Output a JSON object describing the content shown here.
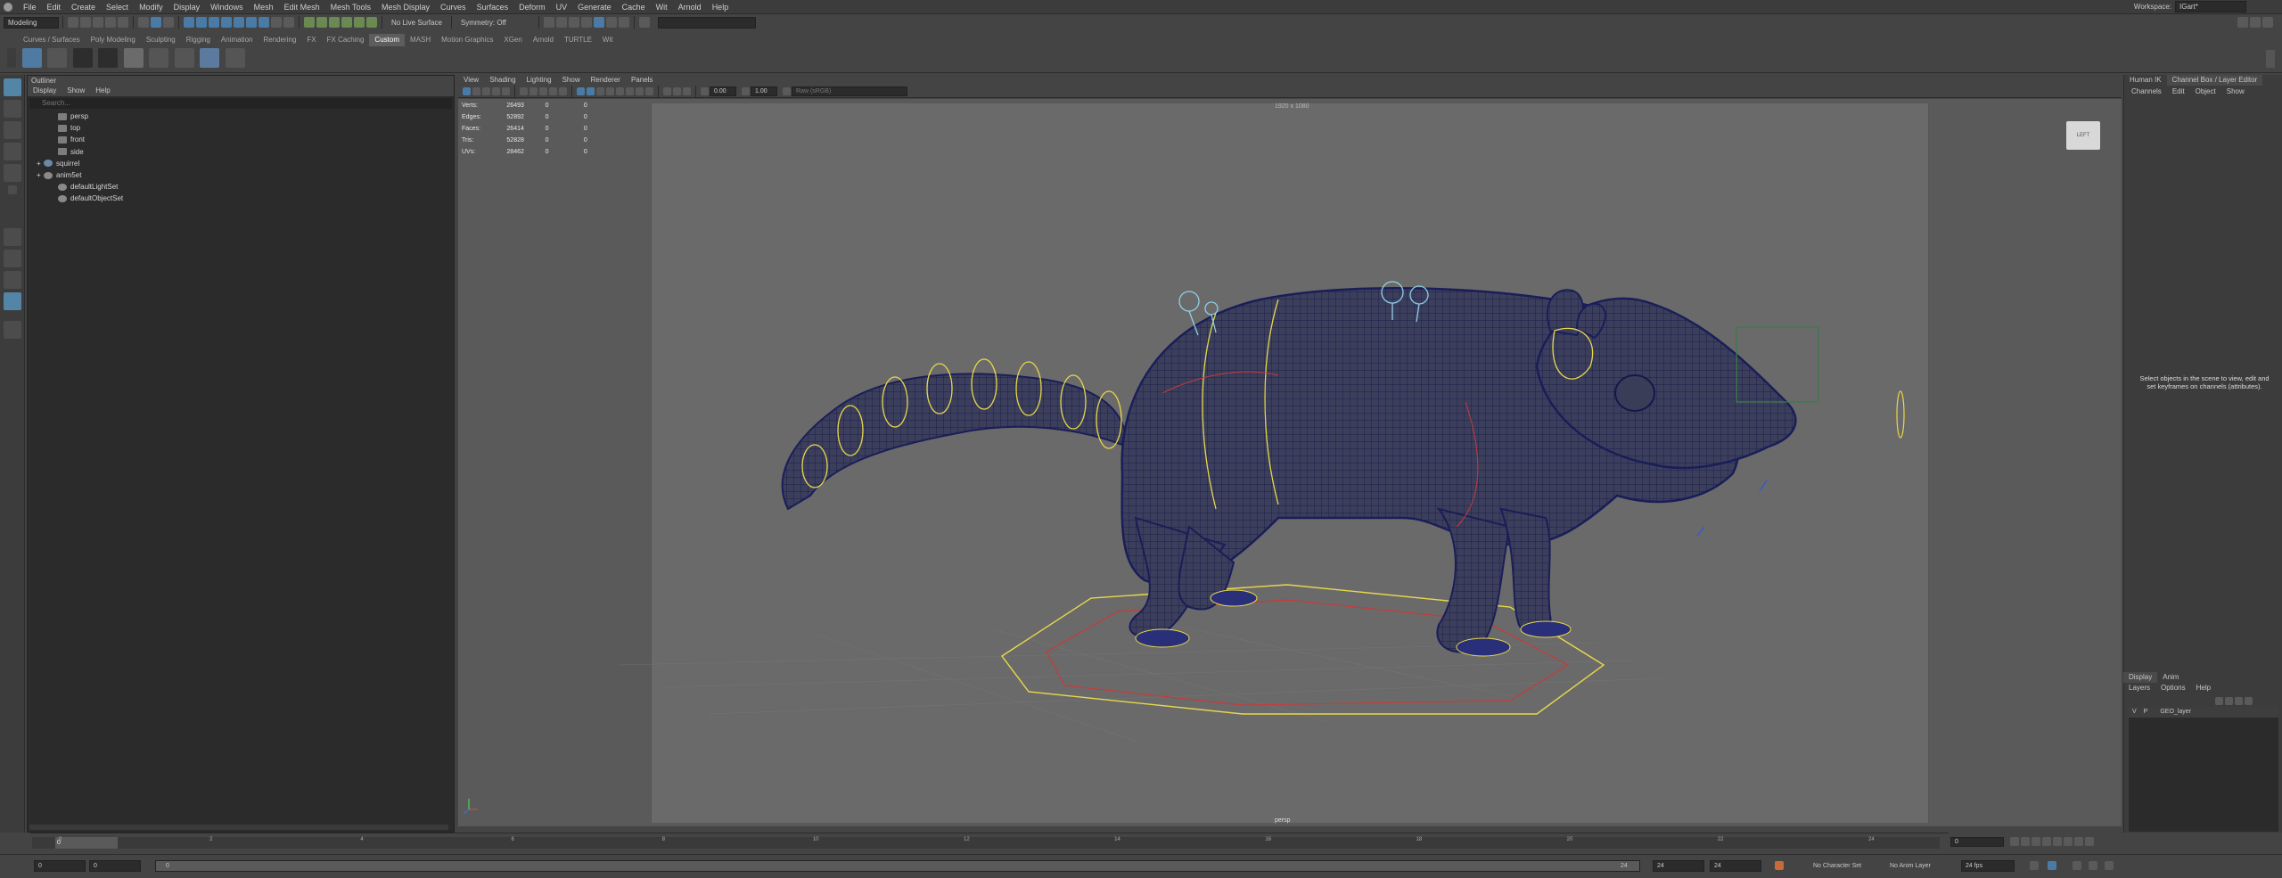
{
  "menus": [
    "File",
    "Edit",
    "Create",
    "Select",
    "Modify",
    "Display",
    "Windows",
    "Mesh",
    "Edit Mesh",
    "Mesh Tools",
    "Mesh Display",
    "Curves",
    "Surfaces",
    "Deform",
    "UV",
    "Generate",
    "Cache",
    "Wit",
    "Arnold",
    "Help"
  ],
  "mode_menu": "Modeling",
  "workspace_label": "Workspace:",
  "workspace_value": "IGart*",
  "live_surface": "No Live Surface",
  "symmetry": "Symmetry: Off",
  "shelf_tabs": [
    "Curves / Surfaces",
    "Poly Modeling",
    "Sculpting",
    "Rigging",
    "Animation",
    "Rendering",
    "FX",
    "FX Caching",
    "Custom",
    "MASH",
    "Motion Graphics",
    "XGen",
    "Arnold",
    "TURTLE",
    "Wit"
  ],
  "shelf_active": "Custom",
  "outliner": {
    "title": "Outliner",
    "menu": [
      "Display",
      "Show",
      "Help"
    ],
    "search_placeholder": "Search...",
    "items": [
      {
        "label": "persp",
        "indent": 1,
        "icon": "camera-icon"
      },
      {
        "label": "top",
        "indent": 1,
        "icon": "camera-icon"
      },
      {
        "label": "front",
        "indent": 1,
        "icon": "camera-icon"
      },
      {
        "label": "side",
        "indent": 1,
        "icon": "camera-icon"
      },
      {
        "label": "squirrel",
        "indent": 0,
        "icon": "group-icon"
      },
      {
        "label": "anim5et",
        "indent": 0,
        "icon": "set-icon"
      },
      {
        "label": "defaultLightSet",
        "indent": 1,
        "icon": "set-icon"
      },
      {
        "label": "defaultObjectSet",
        "indent": 1,
        "icon": "set-icon"
      }
    ]
  },
  "viewport_menu": [
    "View",
    "Shading",
    "Lighting",
    "Show",
    "Renderer",
    "Panels"
  ],
  "vp_fields": {
    "exposure": "0.00",
    "gamma": "1.00",
    "colorspace": "Raw (sRGB)"
  },
  "hud": [
    {
      "k": "Verts:",
      "a": "26493",
      "b": "0",
      "c": "0"
    },
    {
      "k": "Edges:",
      "a": "52892",
      "b": "0",
      "c": "0"
    },
    {
      "k": "Faces:",
      "a": "26414",
      "b": "0",
      "c": "0"
    },
    {
      "k": "Tris:",
      "a": "52828",
      "b": "0",
      "c": "0"
    },
    {
      "k": "UVs:",
      "a": "28462",
      "b": "0",
      "c": "0"
    }
  ],
  "camera_label": "1920 x 1080",
  "persp_label": "persp",
  "viewcube_label": "LEFT",
  "right_tabs": [
    "Human IK",
    "Channel Box / Layer Editor"
  ],
  "cb_menu": [
    "Channels",
    "Edit",
    "Object",
    "Show"
  ],
  "cb_message": "Select objects in the scene to view, edit and set keyframes on channels (attributes).",
  "layer_tabs": [
    "Display",
    "Anim"
  ],
  "layer_menu": [
    "Layers",
    "Options",
    "Help"
  ],
  "layer": {
    "v": "V",
    "p": "P",
    "name": "GEO_layer"
  },
  "timeline_ticks": [
    "0",
    "2",
    "4",
    "6",
    "8",
    "10",
    "12",
    "14",
    "16",
    "18",
    "20",
    "22",
    "24"
  ],
  "current_frame": "0",
  "range": {
    "start": "0",
    "start2": "0",
    "slider_start": "0",
    "slider_end": "24",
    "end": "24",
    "end2": "24"
  },
  "char_set": "No Character Set",
  "anim_layer": "No Anim Layer",
  "fps": "24 fps"
}
